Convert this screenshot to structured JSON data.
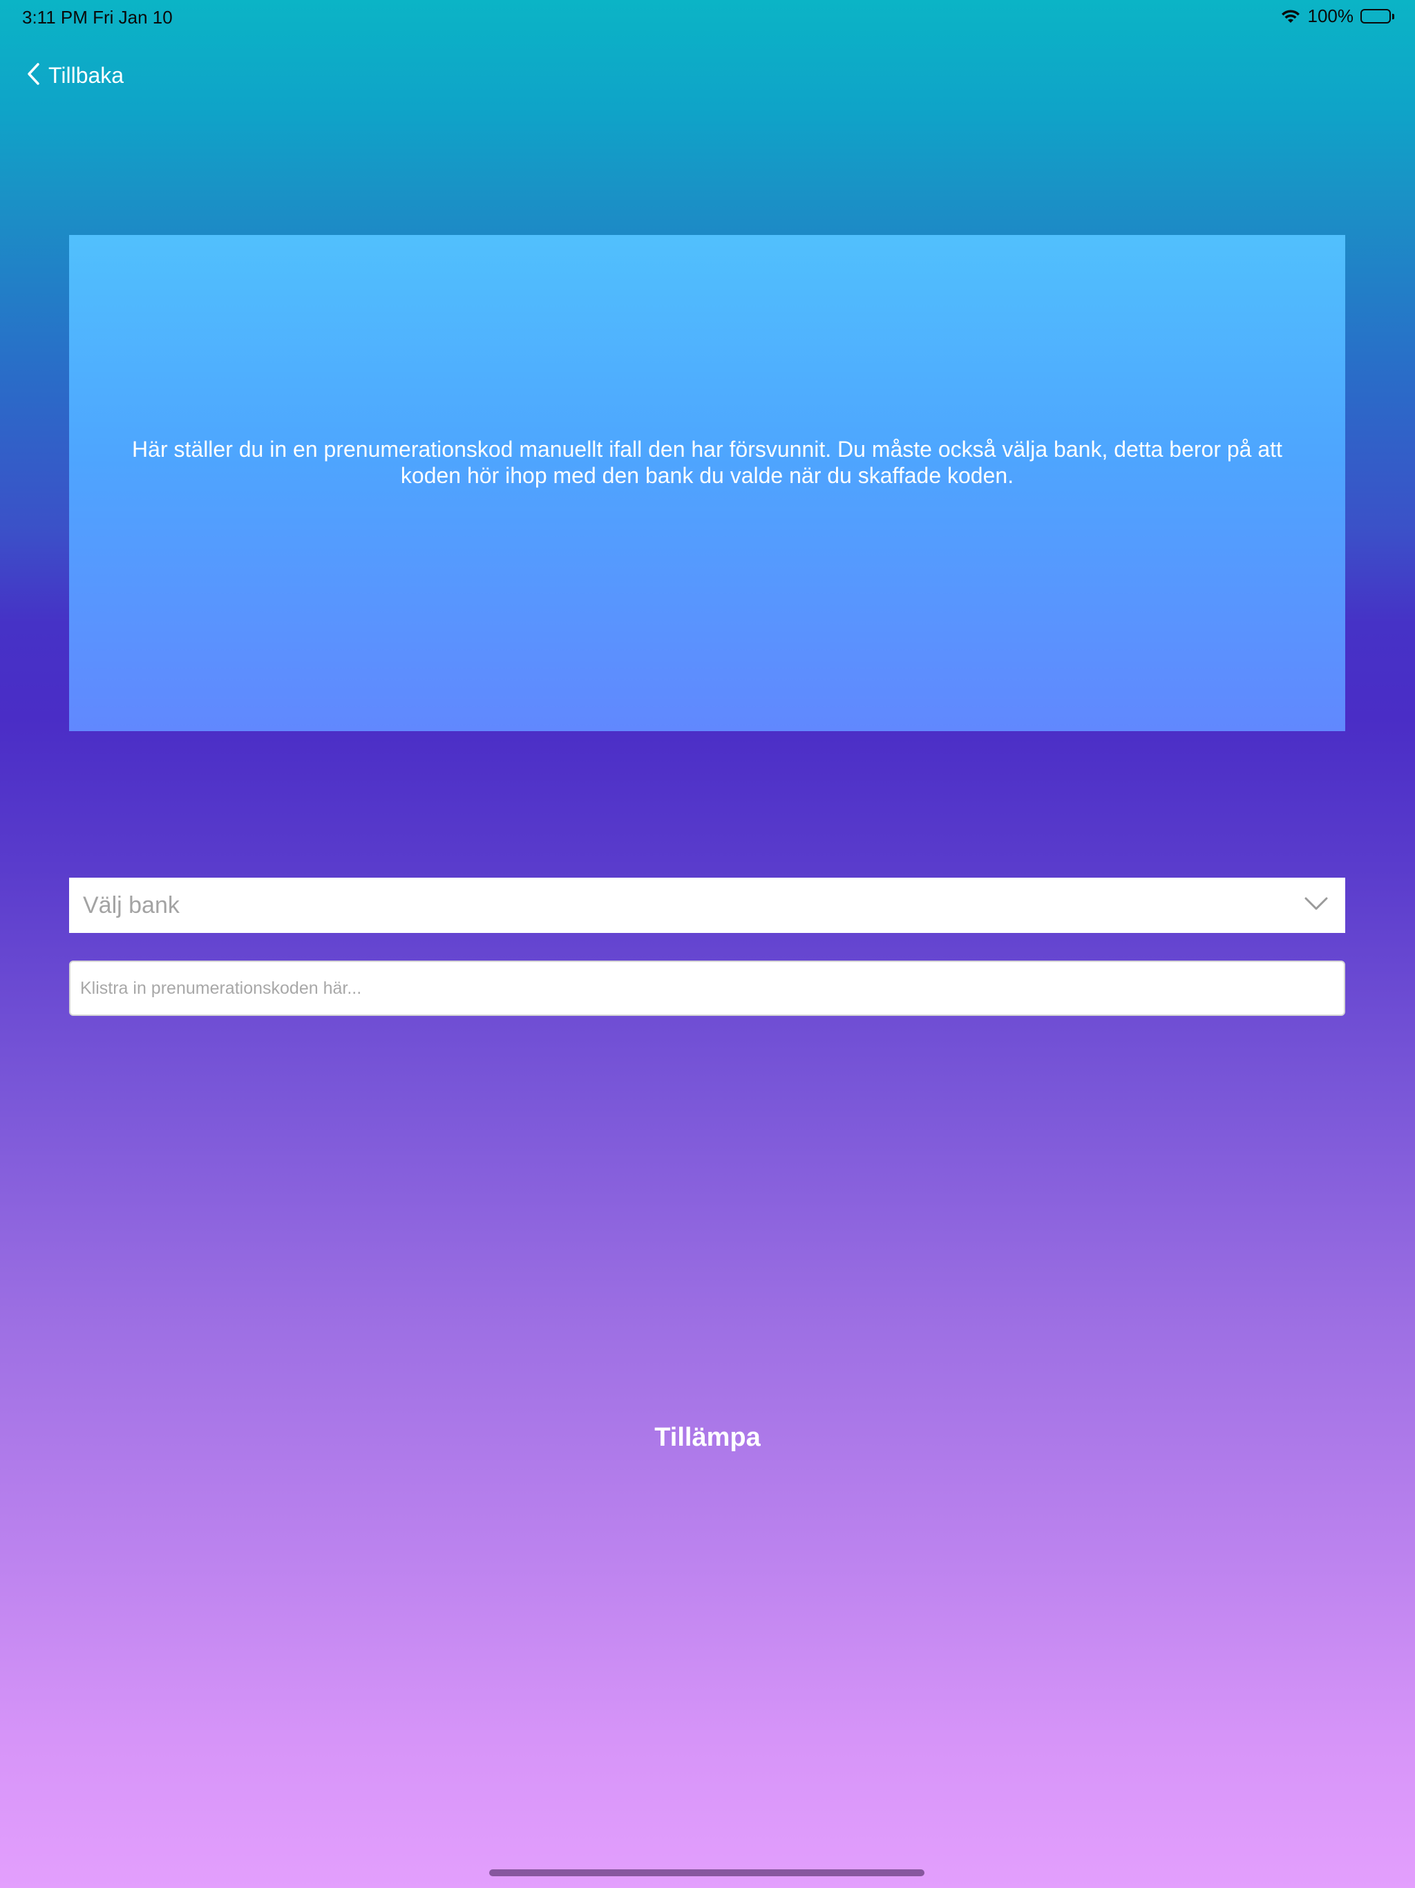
{
  "status_bar": {
    "time_date": "3:11 PM   Fri Jan 10",
    "battery_percent": "100%",
    "wifi_icon": "wifi-icon",
    "battery_icon": "battery-icon"
  },
  "nav": {
    "back_label": "Tillbaka",
    "back_icon": "chevron-left-icon"
  },
  "info": {
    "text": "Här ställer du in en prenumerationskod manuellt ifall den har försvunnit. Du måste också välja bank, detta beror på att koden hör ihop med den bank du valde när du skaffade koden."
  },
  "form": {
    "bank_select_placeholder": "Välj bank",
    "bank_select_icon": "chevron-down-icon",
    "code_input_placeholder": "Klistra in prenumerationskoden här...",
    "code_input_value": ""
  },
  "actions": {
    "apply_label": "Tillämpa"
  },
  "colors": {
    "gradient_top": "#0bb4c6",
    "gradient_middle": "#4a2dc6",
    "gradient_bottom": "#e39ffd",
    "info_panel_top": "#51c0fd",
    "info_panel_bottom": "#6188fe",
    "text": "#ffffff"
  }
}
